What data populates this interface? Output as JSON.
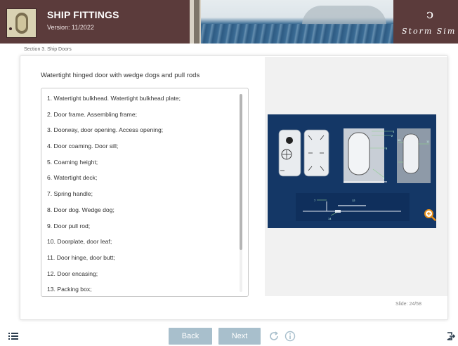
{
  "header": {
    "title": "SHIP FITTINGS",
    "version": "Version: 11/2022",
    "brand": "Storm Sim"
  },
  "breadcrumb": "Section 3. Ship Doors",
  "content": {
    "title": "Watertight hinged door with wedge dogs and pull rods",
    "items": [
      "1. Watertight bulkhead. Watertight bulkhead plate;",
      "2. Door frame. Assembling frame;",
      "3. Doorway, door opening. Access opening;",
      "4. Door coaming. Door sill;",
      "5. Coaming height;",
      "6. Watertight deck;",
      "7. Spring handle;",
      "8. Door dog. Wedge dog;",
      "9. Door pull rod;",
      "10. Doorplate, door leaf;",
      "11. Door hinge, door butt;",
      "12. Door encasing;",
      "13. Packing box;"
    ]
  },
  "slide_counter": "Slide: 24/58",
  "nav": {
    "back_label": "Back",
    "next_label": "Next"
  },
  "icons": {
    "menu": "menu-list-icon",
    "zoom": "zoom-in-icon",
    "reload": "reload-icon",
    "info": "info-icon",
    "exit": "exit-icon"
  },
  "colors": {
    "header_bg": "#5b3b3b",
    "diagram_bg": "#143766",
    "button_bg": "#a8bfcc",
    "zoom_accent": "#e8901a"
  }
}
